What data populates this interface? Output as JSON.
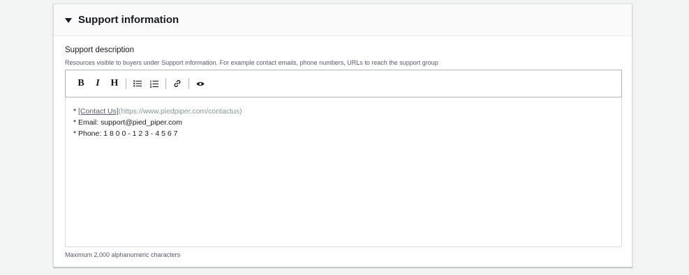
{
  "section": {
    "title": "Support information",
    "expanded": true
  },
  "field": {
    "label": "Support description",
    "description": "Resources visible to buyers under Support information. For example contact emails, phone numbers, URLs to reach the support group",
    "constraint": "Maximum 2,000 alphanumeric characters"
  },
  "toolbar": {
    "bold": "B",
    "italic": "I",
    "heading": "H"
  },
  "content": {
    "line1_prefix": "* ",
    "line1_link": "[Contact Us]",
    "line1_url": "(https://www.piedpiper.com/contactus)",
    "line2": "* Email: support@pied_piper.com",
    "line3": "* Phone: 1 8 0 0 - 1 2 3 - 4 5 6 7"
  }
}
